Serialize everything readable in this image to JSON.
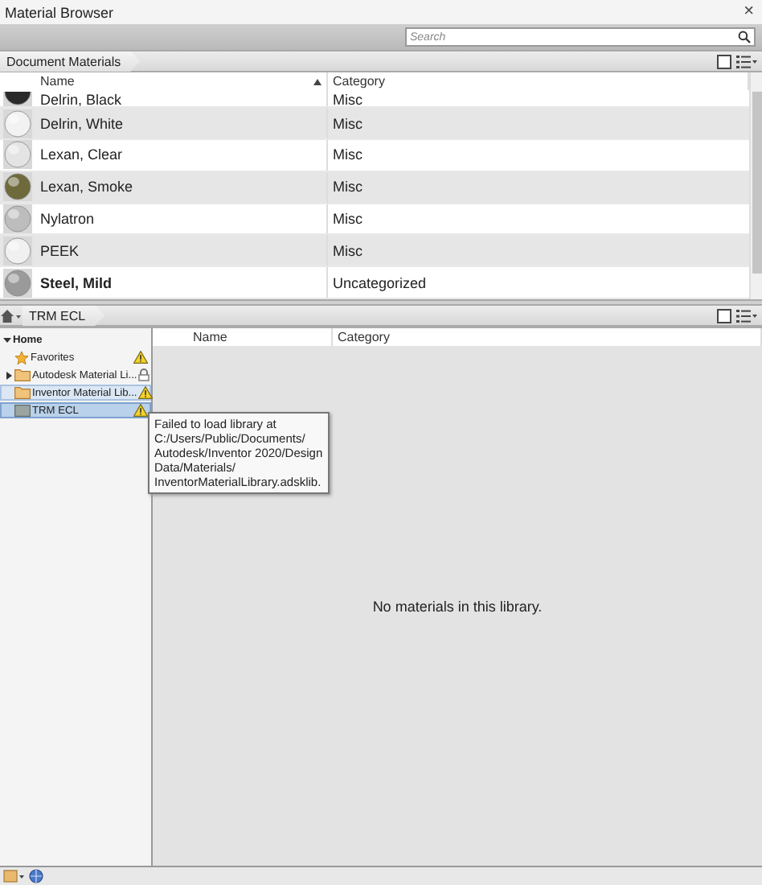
{
  "window": {
    "title": "Material Browser",
    "close": "×"
  },
  "search": {
    "placeholder": "Search"
  },
  "document_breadcrumb": {
    "label": "Document Materials"
  },
  "materials_table": {
    "columns": [
      {
        "label": "Name",
        "sorted": true
      },
      {
        "label": "Category",
        "sorted": false
      }
    ],
    "rows": [
      {
        "name": "Delrin, Black",
        "category": "Misc",
        "color": "#2a2a2a",
        "bold": false,
        "partial": true
      },
      {
        "name": "Delrin, White",
        "category": "Misc",
        "color": "#f2f2f2",
        "bold": false,
        "partial": false
      },
      {
        "name": "Lexan, Clear",
        "category": "Misc",
        "color": "#e4e4e4",
        "bold": false,
        "partial": false
      },
      {
        "name": "Lexan, Smoke",
        "category": "Misc",
        "color": "#6e6a3c",
        "bold": false,
        "partial": false
      },
      {
        "name": "Nylatron",
        "category": "Misc",
        "color": "#bdbdbd",
        "bold": false,
        "partial": false
      },
      {
        "name": "PEEK",
        "category": "Misc",
        "color": "#f0f0f0",
        "bold": false,
        "partial": false
      },
      {
        "name": "Steel, Mild",
        "category": "Uncategorized",
        "color": "#9a9a9a",
        "bold": true,
        "partial": false
      }
    ]
  },
  "library_breadcrumb": {
    "label": "TRM ECL"
  },
  "library_tree": {
    "label": "Home",
    "expanded": true,
    "children": [
      {
        "label": "Favorites",
        "kind": "favorites",
        "warning": true,
        "locked": false,
        "selected": false,
        "hover": false,
        "has_children": false
      },
      {
        "label": "Autodesk Material Li...",
        "kind": "folder",
        "warning": false,
        "locked": true,
        "selected": false,
        "hover": false,
        "has_children": true
      },
      {
        "label": "Inventor Material Lib...",
        "kind": "folder",
        "warning": true,
        "locked": false,
        "selected": false,
        "hover": true,
        "has_children": false
      },
      {
        "label": "TRM ECL",
        "kind": "library",
        "warning": true,
        "locked": false,
        "selected": true,
        "hover": false,
        "has_children": false
      }
    ]
  },
  "tooltip": {
    "lines": [
      "Failed to load library at",
      "C:/Users/Public/Documents/",
      "Autodesk/Inventor 2020/Design",
      "Data/Materials/",
      "InventorMaterialLibrary.adsklib."
    ]
  },
  "library_table": {
    "columns": [
      {
        "label": "Name"
      },
      {
        "label": "Category"
      }
    ],
    "empty_message": "No materials in this library."
  }
}
